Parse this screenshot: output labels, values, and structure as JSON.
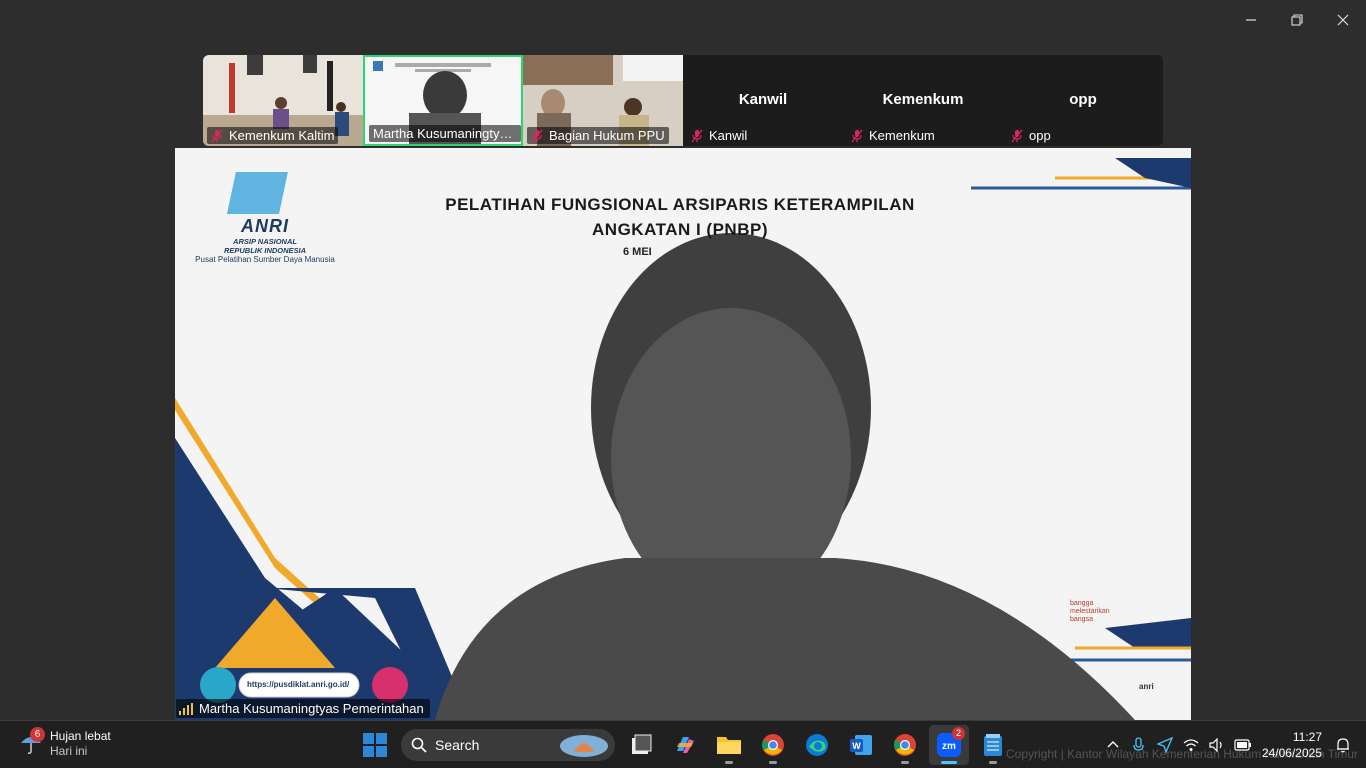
{
  "gallery": {
    "tiles": [
      {
        "label": "Kemenkum Kaltim",
        "type": "video"
      },
      {
        "label": "Martha Kusumaningtyas ...",
        "type": "video",
        "active": true
      },
      {
        "label": "Bagian Hukum PPU",
        "type": "video"
      },
      {
        "label": "Kanwil",
        "big": "Kanwil",
        "type": "name"
      },
      {
        "label": "Kemenkum",
        "big": "Kemenkum",
        "type": "name"
      },
      {
        "label": "opp",
        "big": "opp",
        "type": "name"
      }
    ]
  },
  "slide": {
    "title_line1": "PELATIHAN FUNGSIONAL ARSIPARIS KETERAMPILAN",
    "title_line2": "ANGKATAN I (PNBP)",
    "date_partial": "6 MEI",
    "logo_text": "ANRI",
    "logo_sub1": "ARSIP NASIONAL",
    "logo_sub2": "REPUBLIK INDONESIA",
    "logo_sub3": "Pusat Pelatihan Sumber Daya Manusia",
    "url": "https://pusdiklat.anri.go.id/",
    "slogan": "bangga\nmelestarikan\nbangsa",
    "corner_text": "anri"
  },
  "speaker": {
    "name": "Martha Kusumaningtyas Pemerintahan"
  },
  "taskbar": {
    "weather_badge": "6",
    "weather_title": "Hujan lebat",
    "weather_sub": "Hari ini",
    "search_placeholder": "Search",
    "zoom_badge": "2",
    "time": "11:27",
    "date": "24/06/2025",
    "watermark": "Copyright | Kantor Wilayah Kementerian Hukum Kalimantan Timur"
  },
  "colors": {
    "active_tile_border": "#2ed573",
    "mic_muted": "#e0245e",
    "accent": "#4cc2ff"
  }
}
